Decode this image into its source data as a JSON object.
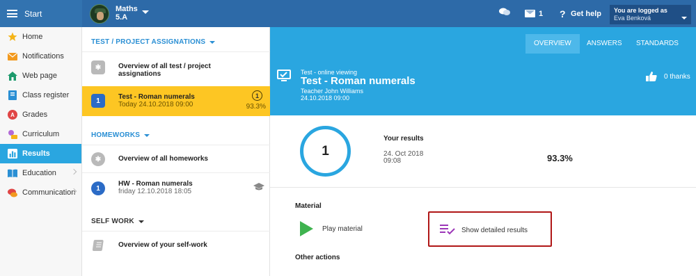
{
  "topbar": {
    "start_label": "Start",
    "class_name": "Maths",
    "class_code": "5.A",
    "messages_count": "1",
    "help_q": "?",
    "help_label": "Get help",
    "logged_as_label": "You are logged as",
    "user_name": "Eva Benková"
  },
  "sidebar": {
    "items": [
      {
        "label": "Home",
        "icon": "star-icon"
      },
      {
        "label": "Notifications",
        "icon": "envelope-icon"
      },
      {
        "label": "Web page",
        "icon": "house-icon"
      },
      {
        "label": "Class register",
        "icon": "register-icon"
      },
      {
        "label": "Grades",
        "icon": "grades-icon"
      },
      {
        "label": "Curriculum",
        "icon": "curriculum-icon"
      },
      {
        "label": "Results",
        "icon": "bar-chart-icon",
        "active": true
      },
      {
        "label": "Education",
        "icon": "book-icon"
      },
      {
        "label": "Communication",
        "icon": "chat-icon"
      }
    ]
  },
  "mid": {
    "test_section": "TEST / PROJECT ASSIGNATIONS",
    "overview_tests": "Overview of all test / project assignations",
    "test_num": "1",
    "test_title": "Test - Roman numerals",
    "test_date": "Today 24.10.2018 09:00",
    "test_score": "1",
    "test_pct": "93.3%",
    "homework_section": "HOMEWORKS",
    "overview_homeworks": "Overview of all homeworks",
    "hw_num": "1",
    "hw_title": "HW - Roman numerals",
    "hw_date": "friday 12.10.2018 18:05",
    "selfwork_section": "SELF WORK",
    "overview_selfwork": "Overview of your self-work"
  },
  "right": {
    "tabs": [
      "OVERVIEW",
      "ANSWERS",
      "STANDARDS"
    ],
    "kicker": "Test - online viewing",
    "title": "Test - Roman numerals",
    "teacher": "Teacher John Williams",
    "date": "24.10.2018 09:00",
    "thanks": "0 thanks",
    "grade": "1",
    "results_label": "Your results",
    "result_date": "24. Oct 2018",
    "result_time": "09:08",
    "result_pct": "93.3%",
    "material_label": "Material",
    "play_label": "Play material",
    "detail_label": "Show detailed results",
    "other_label": "Other actions"
  },
  "colors": {
    "topbar": "#2d6aa8",
    "accent": "#2aa6e0",
    "highlight": "#fdc623",
    "play": "#3fb34f",
    "detail_box": "#b01616"
  }
}
